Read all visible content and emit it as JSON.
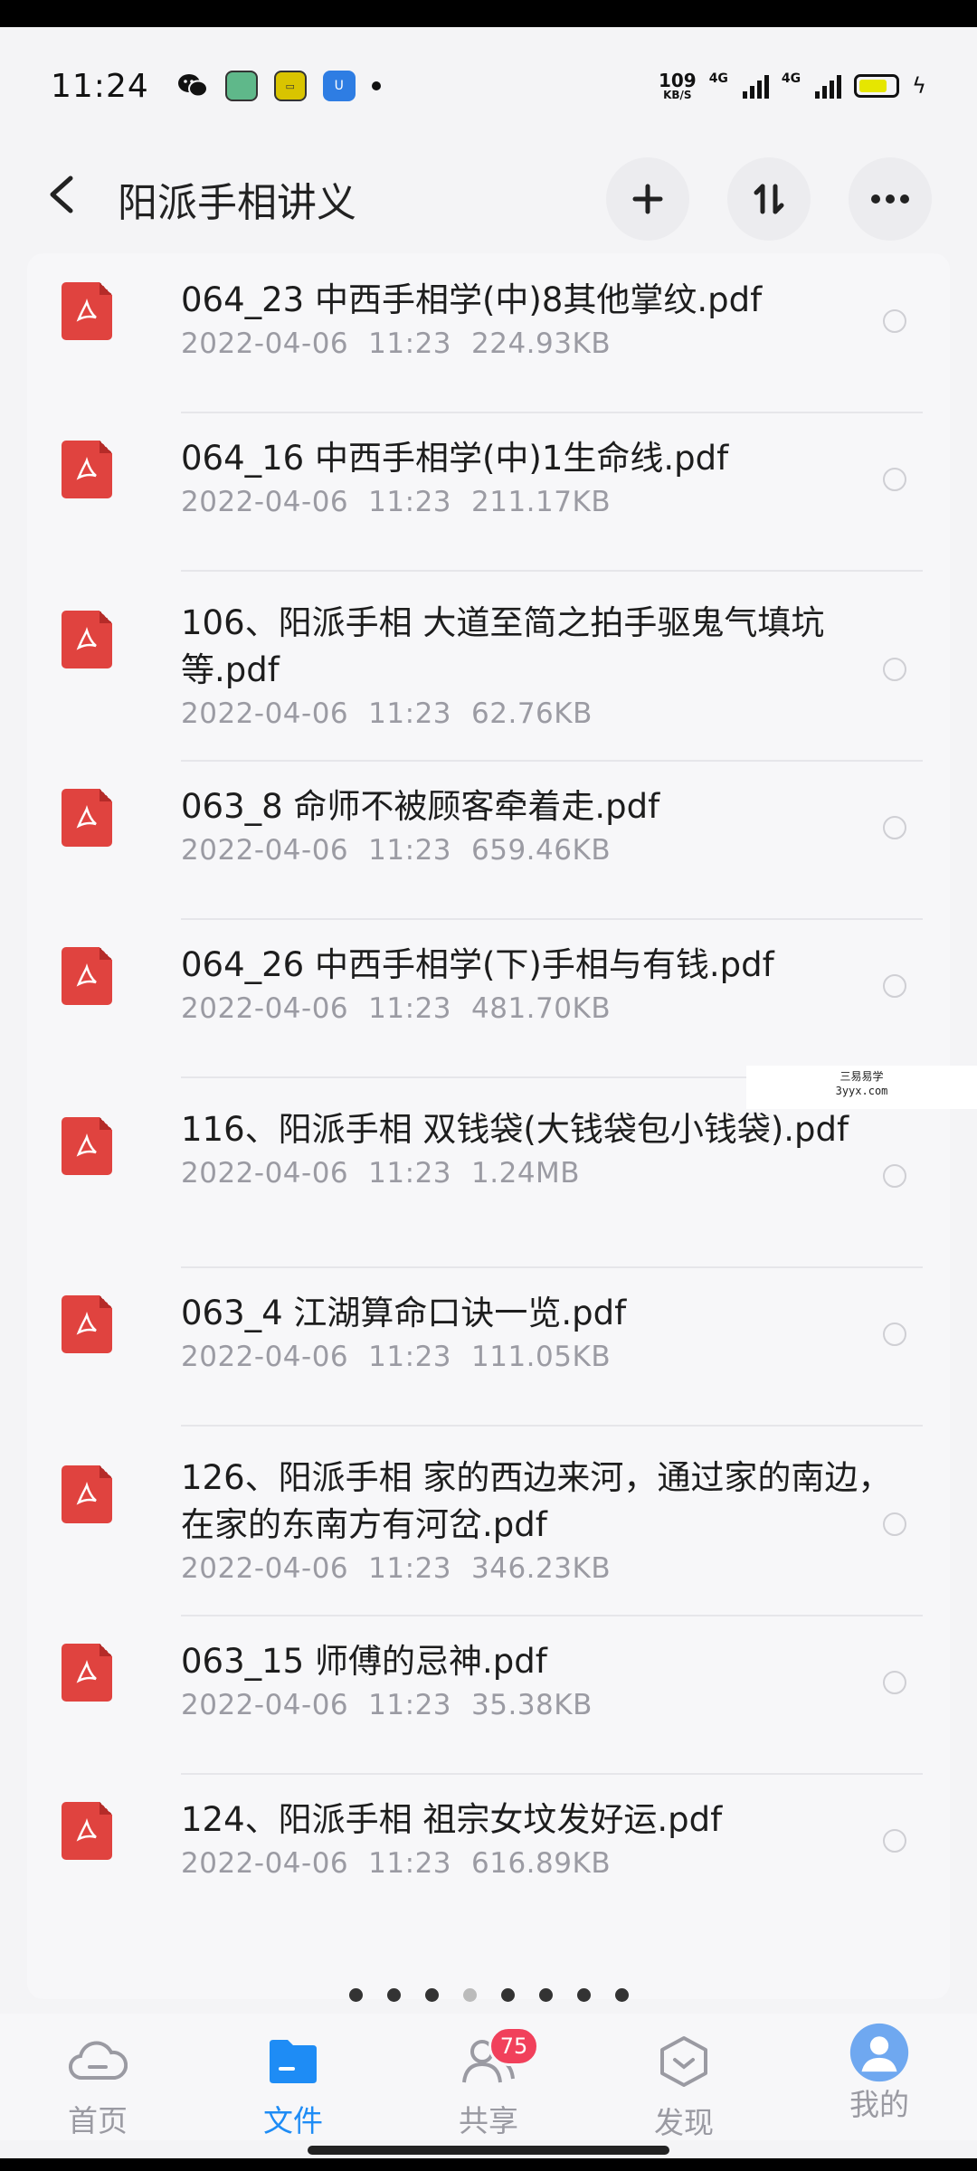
{
  "status_bar": {
    "time": "11:24",
    "app_icons": [
      "wechat-icon",
      "green-app-icon",
      "yellow-app-icon",
      "blue-shield-icon"
    ],
    "speed_value": "109",
    "speed_unit": "KB/S",
    "sim1": "4G",
    "sim2": "4G",
    "battery_color": "#e6e600"
  },
  "header": {
    "title": "阳派手相讲义",
    "back_icon": "chevron-left-icon",
    "add_label": "+",
    "sort_label": "⇅",
    "more_label": "···"
  },
  "files": [
    {
      "name": "064_23  中西手相学(中)8其他掌纹.pdf",
      "date": "2022-04-06",
      "time": "11:23",
      "size": "224.93KB"
    },
    {
      "name": "064_16  中西手相学(中)1生命线.pdf",
      "date": "2022-04-06",
      "time": "11:23",
      "size": "211.17KB"
    },
    {
      "name": "106、阳派手相 大道至简之拍手驱鬼气填坑等.pdf",
      "date": "2022-04-06",
      "time": "11:23",
      "size": "62.76KB"
    },
    {
      "name": "063_8  命师不被顾客牵着走.pdf",
      "date": "2022-04-06",
      "time": "11:23",
      "size": "659.46KB"
    },
    {
      "name": "064_26  中西手相学(下)手相与有钱.pdf",
      "date": "2022-04-06",
      "time": "11:23",
      "size": "481.70KB"
    },
    {
      "name": "116、阳派手相 双钱袋(大钱袋包小钱袋).pdf",
      "date": "2022-04-06",
      "time": "11:23",
      "size": "1.24MB"
    },
    {
      "name": "063_4  江湖算命口诀一览.pdf",
      "date": "2022-04-06",
      "time": "11:23",
      "size": "111.05KB"
    },
    {
      "name": "126、阳派手相 家的西边来河，通过家的南边，在家的东南方有河岔.pdf",
      "date": "2022-04-06",
      "time": "11:23",
      "size": "346.23KB"
    },
    {
      "name": "063_15  师傅的忌神.pdf",
      "date": "2022-04-06",
      "time": "11:23",
      "size": "35.38KB"
    },
    {
      "name": "124、阳派手相 祖宗女坟发好运.pdf",
      "date": "2022-04-06",
      "time": "11:23",
      "size": "616.89KB"
    }
  ],
  "watermark": {
    "line1": "三易易学",
    "line2": "3yyx.com"
  },
  "pager": {
    "count": 8,
    "inactive_index": 3
  },
  "bottom_nav": {
    "items": [
      {
        "label": "首页",
        "icon": "cloud-icon"
      },
      {
        "label": "文件",
        "icon": "folder-icon"
      },
      {
        "label": "共享",
        "icon": "people-icon"
      },
      {
        "label": "发现",
        "icon": "discover-icon"
      },
      {
        "label": "我的",
        "icon": "avatar-icon"
      }
    ],
    "active_index": 1,
    "share_badge": "75",
    "active_color": "#1e8cf5"
  }
}
